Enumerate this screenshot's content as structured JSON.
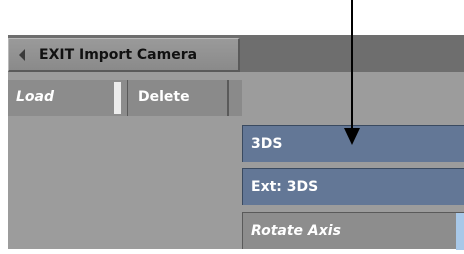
{
  "header": {
    "exit_label": "EXIT Import Camera"
  },
  "actions": {
    "load_label": "Load",
    "delete_label": "Delete"
  },
  "fields": {
    "format_value": "3DS",
    "extension_value": "Ext: 3DS",
    "rotate_axis_label": "Rotate Axis"
  },
  "colors": {
    "field_blue": "#637796",
    "panel_gray": "#9c9c9c",
    "accent_light_blue": "#a8c8e8"
  },
  "icons": {
    "exit": "triangle-left-icon",
    "callout": "arrow-down-icon"
  }
}
